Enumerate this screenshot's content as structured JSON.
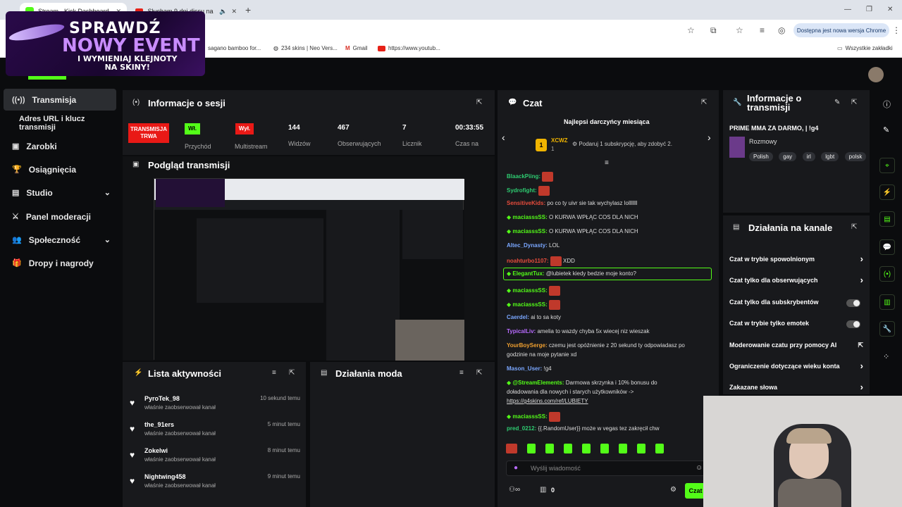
{
  "browser": {
    "tabs": [
      {
        "label": "Stream - Kick Dashboard"
      },
      {
        "label": "Słucham 9 dni dissu na raka"
      }
    ],
    "update_label": "Dostępna jest nowa wersja Chrome",
    "bookmarks": [
      "sagano bamboo for...",
      "234 skins | Neo Vers...",
      "Gmail",
      "https://www.youtub..."
    ],
    "all_bookmarks": "Wszystkie zakładki"
  },
  "promo": {
    "line1": "SPRAWDŹ",
    "line2": "NOWY EVENT",
    "line3": "I WYMIENIAJ KLEJNOTY",
    "line4": "NA SKINY!"
  },
  "sidebar": {
    "items": [
      {
        "label": "Transmisja",
        "icon": "broadcast-icon"
      },
      {
        "label": "Adres URL i klucz transmisji",
        "icon": ""
      },
      {
        "label": "Zarobki",
        "icon": "earnings-icon"
      },
      {
        "label": "Osiągnięcia",
        "icon": "trophy-icon"
      },
      {
        "label": "Studio",
        "icon": "studio-icon"
      },
      {
        "label": "Panel moderacji",
        "icon": "sword-icon"
      },
      {
        "label": "Społeczność",
        "icon": "community-icon"
      },
      {
        "label": "Dropy i nagrody",
        "icon": "gift-icon"
      }
    ]
  },
  "session": {
    "title": "Informacje o sesji",
    "live_label": "TRANSMISJA TRWA",
    "przychod_badge": "Wł.",
    "przychod_label": "Przychód",
    "multistream_badge": "Wył.",
    "multistream_label": "Multistream",
    "viewers": "144",
    "viewers_label": "Widzów",
    "followers": "467",
    "followers_label": "Obserwujących",
    "counter": "7",
    "counter_label": "Licznik",
    "time": "00:33:55",
    "time_label": "Czas na"
  },
  "preview": {
    "title": "Podgląd transmisji"
  },
  "activity": {
    "title": "Lista aktywności",
    "items": [
      {
        "name": "PyroTek_98",
        "sub": "właśnie zaobserwował kanał",
        "time": "10 sekund temu"
      },
      {
        "name": "the_91ers",
        "sub": "właśnie zaobserwował kanał",
        "time": "5 minut temu"
      },
      {
        "name": "Zokelwi",
        "sub": "właśnie zaobserwował kanał",
        "time": "8 minut temu"
      },
      {
        "name": "Nightwing458",
        "sub": "właśnie zaobserwował kanał",
        "time": "9 minut temu"
      }
    ]
  },
  "modactions": {
    "title": "Działania moda"
  },
  "chat": {
    "title": "Czat",
    "top_donors_title": "Najlepsi darczyńcy miesiąca",
    "donor_rank": "1",
    "donor_name": "XCWZ",
    "donor_count": "1",
    "gift_prompt": "Podaruj 1 subskrypcję, aby zdobyć 2.",
    "messages": [
      {
        "user": "BlaackPiing:",
        "text": "",
        "color": "#2ecc71",
        "emote": true
      },
      {
        "user": "Sydrofight:",
        "text": "",
        "color": "#2ecc71",
        "emote": true
      },
      {
        "user": "SensitiveKids:",
        "text": "po co ty uivr sie tak wychylasz lolllllll",
        "color": "#e74c3c",
        "emote": false
      },
      {
        "user": "maciasssSS:",
        "text": "O KURWA WPŁĄC COS DLA NICH",
        "color": "#53fc18",
        "emote": false
      },
      {
        "user": "maciasssSS:",
        "text": "O KURWA WPŁĄC COS DLA NICH",
        "color": "#53fc18",
        "emote": false
      },
      {
        "user": "Altec_Dynasty:",
        "text": "LOL",
        "color": "#7aa7ff",
        "emote": false
      },
      {
        "user": "noahturbo1107:",
        "text": "XDD",
        "color": "#e74c3c",
        "emote": true
      },
      {
        "user": "ElegantTux:",
        "text": "@lubietek kiedy bedzie moje konto?",
        "color": "#53fc18",
        "emote": false
      },
      {
        "user": "maciasssSS:",
        "text": "",
        "color": "#53fc18",
        "emote": true
      },
      {
        "user": "maciasssSS:",
        "text": "",
        "color": "#53fc18",
        "emote": true
      },
      {
        "user": "Caerdel:",
        "text": "ai to sa koty",
        "color": "#7aa7ff",
        "emote": false
      },
      {
        "user": "TypicalLiv:",
        "text": "amelia to wazdy chyba 5x wiecej niz wieszak",
        "color": "#b86bff",
        "emote": false
      },
      {
        "user": "YourBoySerge:",
        "text": "czemu jest opóźnienie z 20 sekund ty odpowiadasz po",
        "color": "#f0a030",
        "emote": false
      },
      {
        "user": "",
        "text": "godzinie na moje pytanie xd",
        "color": "#ddd",
        "emote": false
      },
      {
        "user": "Mason_User:",
        "text": "!g4",
        "color": "#7aa7ff",
        "emote": false
      },
      {
        "user": "@StreamElements:",
        "text": "Darmowa skrzynka i 10% bonusu do",
        "color": "#53fc18",
        "emote": false
      },
      {
        "user": "",
        "text": "doładowania dla nowych i starych użytkowników ->",
        "color": "#ddd",
        "emote": false
      },
      {
        "user": "",
        "text": "https://g4skins.com/ref/LUBIETY",
        "color": "#ddd",
        "emote": false
      },
      {
        "user": "maciasssSS:",
        "text": "",
        "color": "#53fc18",
        "emote": true
      },
      {
        "user": "pred_0212:",
        "text": "{{.RandomUser}} może w vegas tez zakręcił chw",
        "color": "#2ecc71",
        "emote": false
      }
    ],
    "input_placeholder": "Wyślij wiadomość",
    "points": "0",
    "send_label": "Czat"
  },
  "stream_info": {
    "title": "Informacje o transmisji",
    "stream_title": "PRIME MMA ZA DARMO, | !g4",
    "category": "Rozmowy",
    "tags": [
      "Polish",
      "gay",
      "irl",
      "lgbt",
      "polsk"
    ]
  },
  "channel_actions": {
    "title": "Działania na kanale",
    "rows": [
      {
        "label": "Czat w trybie spowolnionym",
        "control": "arrow"
      },
      {
        "label": "Czat tylko dla obserwujących",
        "control": "arrow"
      },
      {
        "label": "Czat tylko dla subskrybentów",
        "control": "toggle"
      },
      {
        "label": "Czat w trybie tylko emotek",
        "control": "toggle"
      },
      {
        "label": "Moderowanie czatu przy pomocy AI",
        "control": "external"
      },
      {
        "label": "Ograniczenie dotyczące wieku konta",
        "control": "arrow"
      },
      {
        "label": "Zakazane słowa",
        "control": "arrow"
      }
    ]
  },
  "colors": {
    "accent": "#53fc18",
    "live": "#e91916",
    "panel": "#18191c",
    "bg": "#0b0c0e"
  }
}
